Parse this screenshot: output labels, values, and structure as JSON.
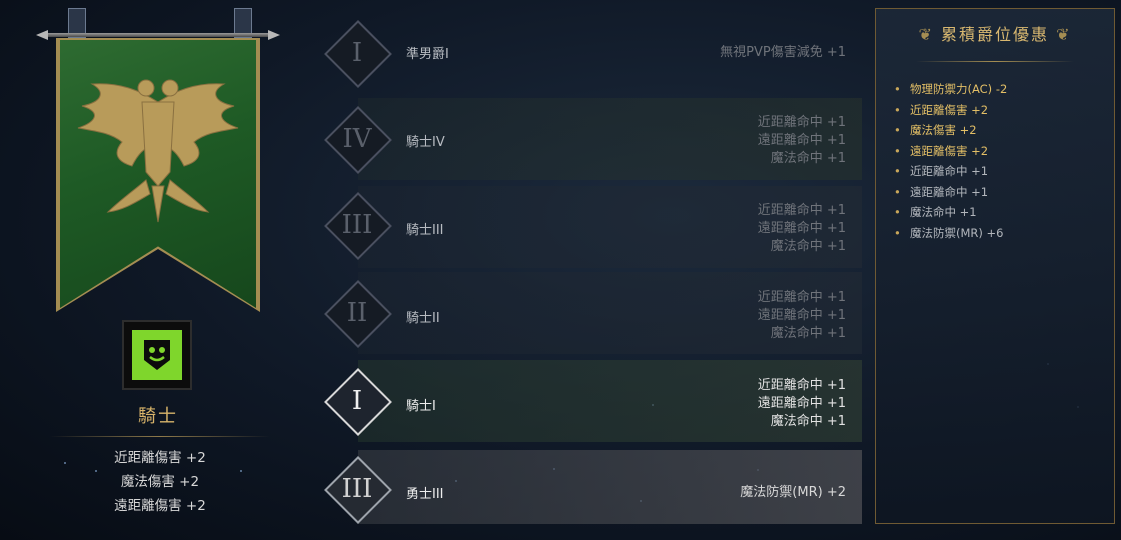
{
  "current_rank": {
    "title": "騎士",
    "stats": [
      "近距離傷害 +2",
      "魔法傷害 +2",
      "遠距離傷害 +2"
    ],
    "emblem_color": "#7fd62c",
    "banner_color": "#1e5a25"
  },
  "tiers": [
    {
      "numeral": "I",
      "name": "準男爵I",
      "bonuses": [
        "無視PVP傷害減免 +1"
      ],
      "state": "locked"
    },
    {
      "numeral": "IV",
      "name": "騎士IV",
      "bonuses": [
        "近距離命中 +1",
        "遠距離命中 +1",
        "魔法命中 +1"
      ],
      "state": "locked"
    },
    {
      "numeral": "III",
      "name": "騎士III",
      "bonuses": [
        "近距離命中 +1",
        "遠距離命中 +1",
        "魔法命中 +1"
      ],
      "state": "locked"
    },
    {
      "numeral": "II",
      "name": "騎士II",
      "bonuses": [
        "近距離命中 +1",
        "遠距離命中 +1",
        "魔法命中 +1"
      ],
      "state": "locked"
    },
    {
      "numeral": "I",
      "name": "騎士I",
      "bonuses": [
        "近距離命中 +1",
        "遠距離命中 +1",
        "魔法命中 +1"
      ],
      "state": "current"
    },
    {
      "numeral": "III",
      "name": "勇士III",
      "bonuses": [
        "魔法防禦(MR) +2"
      ],
      "state": "achieved"
    }
  ],
  "accumulated": {
    "header": "累積爵位優惠",
    "items": [
      {
        "text": "物理防禦力(AC) -2",
        "style": "gold"
      },
      {
        "text": "近距離傷害 +2",
        "style": "gold"
      },
      {
        "text": "魔法傷害 +2",
        "style": "gold"
      },
      {
        "text": "遠距離傷害 +2",
        "style": "gold"
      },
      {
        "text": "近距離命中 +1",
        "style": "plain"
      },
      {
        "text": "遠距離命中 +1",
        "style": "plain"
      },
      {
        "text": "魔法命中 +1",
        "style": "plain"
      },
      {
        "text": "魔法防禦(MR) +6",
        "style": "plain"
      }
    ]
  }
}
